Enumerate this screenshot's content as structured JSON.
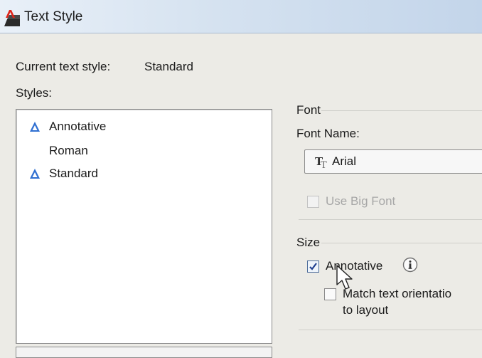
{
  "window": {
    "title": "Text Style",
    "app_icon": "autocad-icon"
  },
  "current_style": {
    "label": "Current text style:",
    "value": "Standard"
  },
  "styles": {
    "label": "Styles:",
    "items": [
      {
        "name": "Annotative",
        "annotative": true
      },
      {
        "name": "Roman",
        "annotative": false
      },
      {
        "name": "Standard",
        "annotative": true
      }
    ]
  },
  "font": {
    "group_label": "Font",
    "name_label": "Font Name:",
    "name_value": "Arial",
    "big_font_label": "Use Big Font",
    "font_icon": "truetype-icon"
  },
  "size": {
    "group_label": "Size",
    "annotative_label": "Annotative",
    "annotative_checked": true,
    "match_label_line1": "Match text orientatio",
    "match_label_line2": "to layout",
    "match_checked": false,
    "info_icon": "info-icon"
  },
  "colors": {
    "annotative_triangle": "#2f6fd1",
    "title_gradient_end": "#c3d5ea"
  }
}
